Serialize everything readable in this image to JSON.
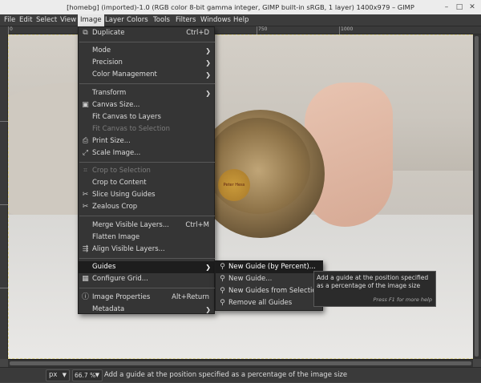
{
  "window": {
    "title": "[homebg] (imported)-1.0 (RGB color 8-bit gamma integer, GIMP built-in sRGB, 1 layer) 1400x979 – GIMP",
    "btn_min": "–",
    "btn_max": "□",
    "btn_close": "✕"
  },
  "menubar": [
    "File",
    "Edit",
    "Select",
    "View",
    "Image",
    "Layer",
    "Colors",
    "Tools",
    "Filters",
    "Windows",
    "Help"
  ],
  "ruler": {
    "h": [
      "0",
      "750",
      "1000"
    ]
  },
  "image_menu": {
    "duplicate": "Duplicate",
    "duplicate_acc": "Ctrl+D",
    "mode": "Mode",
    "precision": "Precision",
    "color_management": "Color Management",
    "transform": "Transform",
    "canvas_size": "Canvas Size...",
    "fit_layers": "Fit Canvas to Layers",
    "fit_selection": "Fit Canvas to Selection",
    "print_size": "Print Size...",
    "scale_image": "Scale Image...",
    "crop_selection": "Crop to Selection",
    "crop_content": "Crop to Content",
    "slice_guides": "Slice Using Guides",
    "zealous_crop": "Zealous Crop",
    "merge_visible": "Merge Visible Layers...",
    "merge_acc": "Ctrl+M",
    "flatten": "Flatten Image",
    "align_visible": "Align Visible Layers...",
    "guides": "Guides",
    "configure_grid": "Configure Grid...",
    "image_properties": "Image Properties",
    "properties_acc": "Alt+Return",
    "metadata": "Metadata"
  },
  "guides_menu": {
    "new_guide_percent": "New Guide (by Percent)...",
    "new_guide": "New Guide...",
    "from_selection": "New Guides from Selection",
    "remove_all": "Remove all Guides"
  },
  "tooltip": {
    "text": "Add a guide at the position specified as a percentage of the image size",
    "help": "Press F1 for more help"
  },
  "photo": {
    "label_text": "Peter Hess"
  },
  "status": {
    "unit": "px",
    "zoom": "66.7 %",
    "message": "Add a guide at the position specified as a percentage of the image size"
  }
}
